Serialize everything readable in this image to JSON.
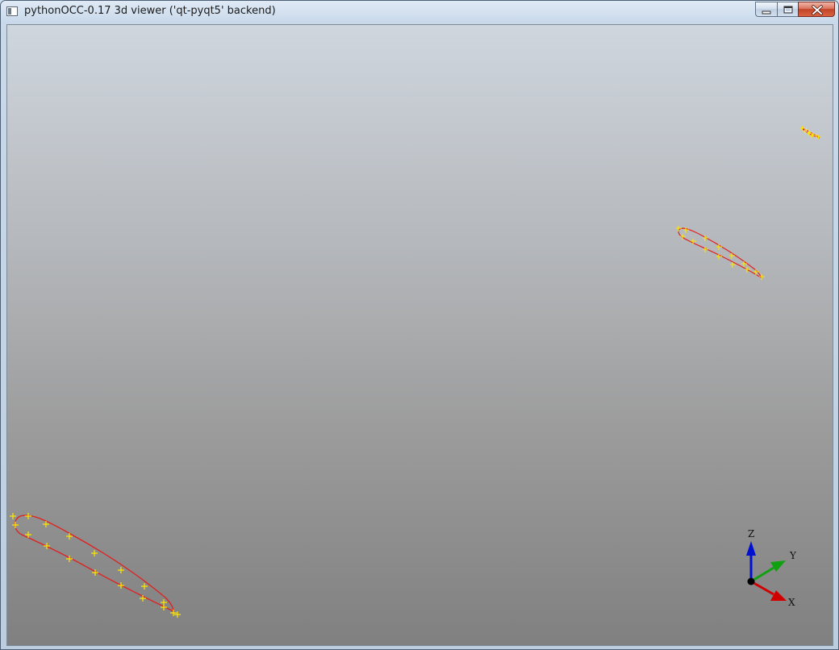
{
  "window": {
    "title": "pythonOCC-0.17 3d viewer ('qt-pyqt5' backend)",
    "controls": [
      "minimize",
      "maximize",
      "close"
    ]
  },
  "viewer": {
    "background": {
      "top": "#cfd6de",
      "bottom": "#808080"
    },
    "curve_color": "#e02020",
    "point_color": "#ffe600",
    "triedron": {
      "labels": {
        "x": "X",
        "y": "Y",
        "z": "Z"
      },
      "colors": {
        "x": "#d00000",
        "y": "#10a010",
        "z": "#0010d0",
        "origin": "#000000"
      }
    }
  }
}
